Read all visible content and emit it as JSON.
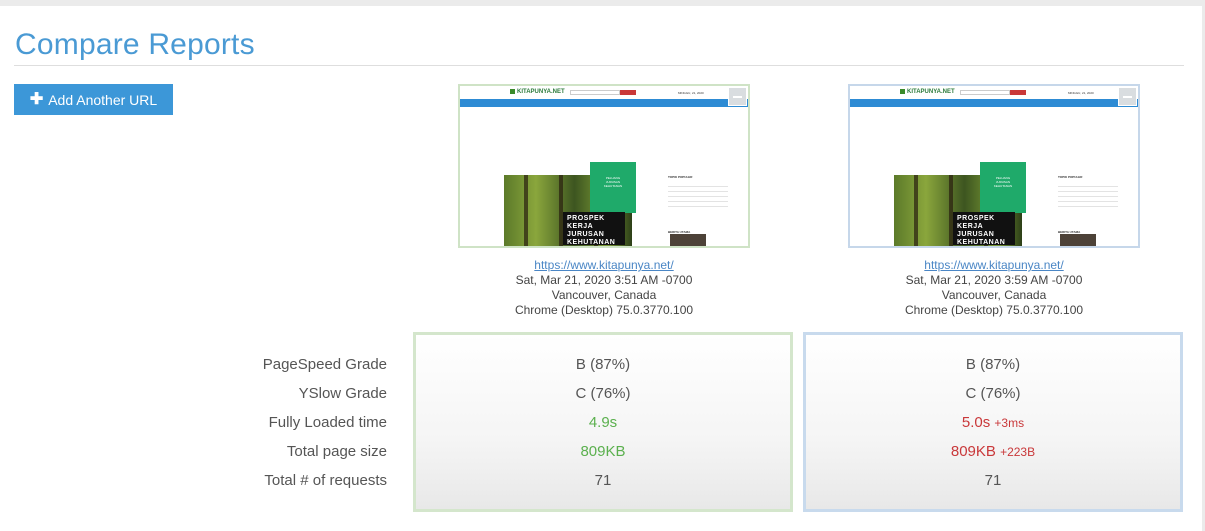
{
  "page": {
    "title": "Compare Reports"
  },
  "toolbar": {
    "add_label": "Add Another URL",
    "add_icon": "plus-icon"
  },
  "screenshot": {
    "logo": "KITAPUNYA.NET",
    "date": "MINGGU, 21, 2020",
    "hero_green_text": "PELUANG JURUSAN KEHUTANAN",
    "hero_title": "PROSPEK KERJA JURUSAN KEHUTANAN",
    "side_heading": "TOPIK POPULER",
    "side_heading2": "BERITA UTAMA"
  },
  "reports": [
    {
      "url": "https://www.kitapunya.net/",
      "date": "Sat, Mar 21, 2020 3:51 AM -0700",
      "location": "Vancouver, Canada",
      "browser": "Chrome (Desktop) 75.0.3770.100",
      "pagespeed": "B (87%)",
      "yslow": "C (76%)",
      "loaded": "4.9s",
      "loaded_diff": "",
      "size": "809KB",
      "size_diff": "",
      "requests": "71",
      "color": "#5bb04e"
    },
    {
      "url": "https://www.kitapunya.net/",
      "date": "Sat, Mar 21, 2020 3:59 AM -0700",
      "location": "Vancouver, Canada",
      "browser": "Chrome (Desktop) 75.0.3770.100",
      "pagespeed": "B (87%)",
      "yslow": "C (76%)",
      "loaded": "5.0s",
      "loaded_diff": "+3ms",
      "size": "809KB",
      "size_diff": "+223B",
      "requests": "71",
      "color": "#c9383a"
    }
  ],
  "metrics": {
    "pagespeed": "PageSpeed Grade",
    "yslow": "YSlow Grade",
    "loaded": "Fully Loaded time",
    "size": "Total page size",
    "requests": "Total # of requests"
  }
}
